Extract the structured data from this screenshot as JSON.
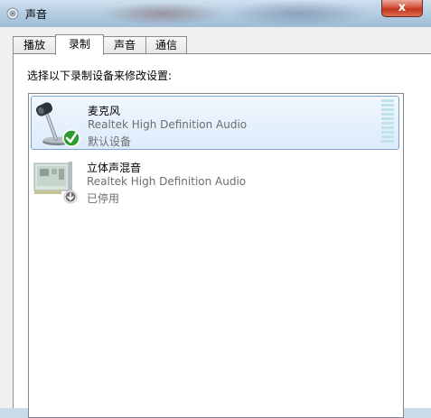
{
  "window": {
    "title": "声音",
    "close_label": "x"
  },
  "tabs": [
    {
      "label": "播放"
    },
    {
      "label": "录制"
    },
    {
      "label": "声音"
    },
    {
      "label": "通信"
    }
  ],
  "active_tab": "录制",
  "instruction": "选择以下录制设备来修改设置:",
  "devices": [
    {
      "name": "麦克风",
      "description": "Realtek High Definition Audio",
      "status": "默认设备",
      "icon": "microphone-icon",
      "badge": "check-icon"
    },
    {
      "name": "立体声混音",
      "description": "Realtek High Definition Audio",
      "status": "已停用",
      "icon": "sound-card-icon",
      "badge": "disabled-arrow-icon"
    }
  ],
  "colors": {
    "selection": "#dcebfb",
    "selection_border": "#7da2ce",
    "close": "#c4351d"
  }
}
